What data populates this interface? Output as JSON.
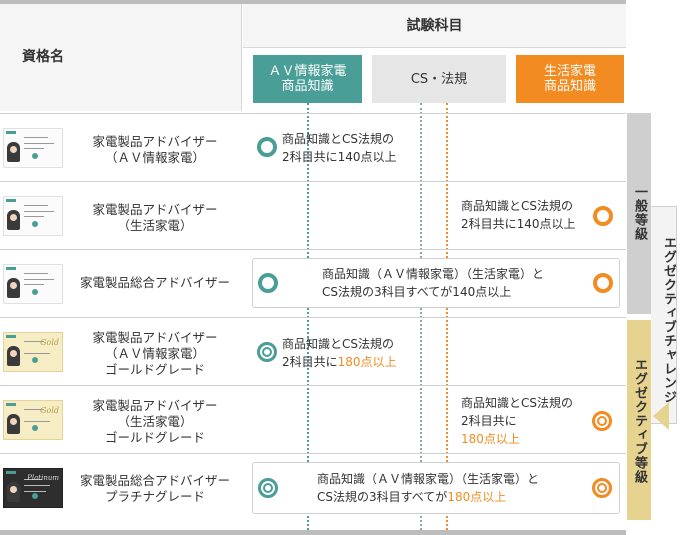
{
  "header": {
    "qualification_label": "資格名",
    "subjects_title": "試験科目",
    "subject_av": "ＡＶ情報家電\n商品知識",
    "subject_cs": "CS・法規",
    "subject_life": "生活家電\n商品知識"
  },
  "rows": [
    {
      "name": "家電製品アドバイザー\n（ＡＶ情報家電）",
      "cond_a": "商品知識とCS法規の\n2科目共に140点以上"
    },
    {
      "name": "家電製品アドバイザー\n（生活家電）",
      "cond_a": "商品知識とCS法規の\n2科目共に140点以上"
    },
    {
      "name": "家電製品総合アドバイザー",
      "cond_a": "商品知識（ＡＶ情報家電）（生活家電）と\nCS法規の3科目すべてが140点以上"
    },
    {
      "name": "家電製品アドバイザー\n（ＡＶ情報家電）\nゴールドグレード",
      "cond_a": "商品知識とCS法規の\n2科目共に",
      "cond_hl": "180点以上"
    },
    {
      "name": "家電製品アドバイザー\n（生活家電）\nゴールドグレード",
      "cond_a": "商品知識とCS法規の\n2科目共に",
      "cond_hl": "180点以上"
    },
    {
      "name": "家電製品総合アドバイザー\nプラチナグレード",
      "cond_a": "商品知識（ＡＶ情報家電）（生活家電）と\nCS法規の3科目すべてが",
      "cond_hl": "180点以上"
    }
  ],
  "cards": {
    "gold_brand": "Gold",
    "platinum_brand": "Platinum"
  },
  "side": {
    "general": "一般等級",
    "executive": "エグゼクティブ等級",
    "challenge": "エグゼクティブチャレンジ"
  },
  "colors": {
    "teal": "#4a9e98",
    "gray": "#e6e6e6",
    "orange": "#f28c22",
    "gold": "#e6d390"
  }
}
